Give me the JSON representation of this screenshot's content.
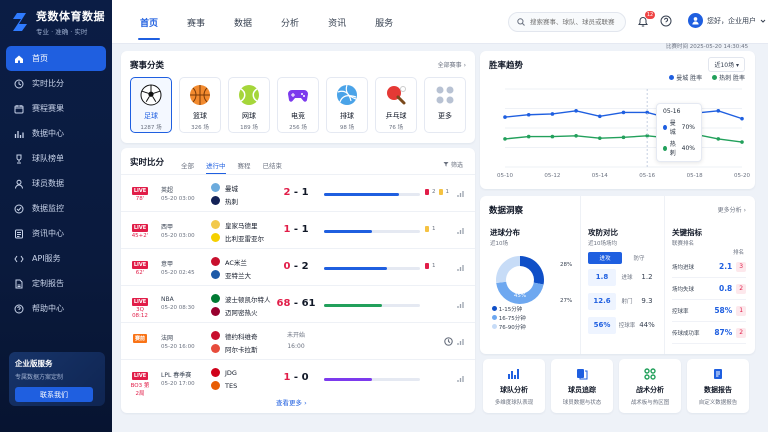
{
  "brand": {
    "title": "竞数体育数据",
    "subtitle": "专业 · 准确 · 实时"
  },
  "sidebar": {
    "items": [
      {
        "label": "首页",
        "icon": "home-icon",
        "active": true
      },
      {
        "label": "实时比分",
        "icon": "clock-icon"
      },
      {
        "label": "赛程赛果",
        "icon": "calendar-icon"
      },
      {
        "label": "数据中心",
        "icon": "chart-icon"
      },
      {
        "label": "球队榜单",
        "icon": "trophy-icon"
      },
      {
        "label": "球员数据",
        "icon": "user-icon"
      },
      {
        "label": "数据监控",
        "icon": "monitor-icon"
      },
      {
        "label": "资讯中心",
        "icon": "news-icon"
      },
      {
        "label": "API服务",
        "icon": "api-icon"
      },
      {
        "label": "定制报告",
        "icon": "report-icon"
      },
      {
        "label": "帮助中心",
        "icon": "help-icon"
      }
    ],
    "enterprise": {
      "title": "企业版服务",
      "subtitle": "专属数据方案定制",
      "button": "联系我们"
    }
  },
  "topnav": {
    "tabs": [
      "首页",
      "赛事",
      "数据",
      "分析",
      "资讯",
      "服务"
    ],
    "active": 0,
    "search_placeholder": "搜索赛事、球队、球员或联赛",
    "notification_count": "12",
    "user_name": "您好，企业用户"
  },
  "update_time": "比赛时间 2025-05-20 14:30:45",
  "sports": {
    "title": "赛事分类",
    "link": "全部赛事",
    "items": [
      {
        "name": "足球",
        "count": "1287 场",
        "icon": "soccer-ball-icon"
      },
      {
        "name": "篮球",
        "count": "326 场",
        "icon": "basketball-icon"
      },
      {
        "name": "网球",
        "count": "189 场",
        "icon": "tennis-ball-icon"
      },
      {
        "name": "电竞",
        "count": "256 场",
        "icon": "gamepad-icon"
      },
      {
        "name": "排球",
        "count": "98 场",
        "icon": "volleyball-icon"
      },
      {
        "name": "乒乓球",
        "count": "76 场",
        "icon": "pingpong-icon"
      },
      {
        "name": "更多",
        "count": "",
        "icon": "grid-dots-icon"
      }
    ]
  },
  "live": {
    "title": "实时比分",
    "filters": [
      "全部",
      "进行中",
      "赛程",
      "已结束"
    ],
    "active_filter": 1,
    "filter_btn": "筛选",
    "more": "查看更多",
    "matches": [
      {
        "status": "LIVE",
        "minute": "78'",
        "comp": "英超",
        "time": "05-20 03:00",
        "home": "曼城",
        "away": "热刺",
        "score_home": "2",
        "score_away": "1",
        "progress": 0.78,
        "bar_color": "#1f5fe0",
        "red": "2",
        "yellow": "1",
        "home_color": "#6cabdd",
        "away_color": "#132257"
      },
      {
        "status": "LIVE",
        "minute": "45+2'",
        "comp": "西甲",
        "time": "05-20 03:00",
        "home": "皇家马德里",
        "away": "比利亚雷亚尔",
        "score_home": "1",
        "score_away": "1",
        "progress": 0.5,
        "bar_color": "#1f5fe0",
        "red": "",
        "yellow": "1",
        "home_color": "#f2c94c",
        "away_color": "#f5d000"
      },
      {
        "status": "LIVE",
        "minute": "62'",
        "comp": "意甲",
        "time": "05-20 02:45",
        "home": "AC米兰",
        "away": "亚特兰大",
        "score_home": "0",
        "score_away": "2",
        "progress": 0.66,
        "bar_color": "#1f5fe0",
        "red": "1",
        "yellow": "",
        "home_color": "#c8102e",
        "away_color": "#1e5aa8"
      },
      {
        "status": "LIVE",
        "minute": "3Q 08:12",
        "comp": "NBA",
        "time": "05-20 08:30",
        "home": "波士顿凯尔特人",
        "away": "迈阿密热火",
        "score_home": "68",
        "score_away": "61",
        "progress": 0.6,
        "bar_color": "#22a05b",
        "red": "",
        "yellow": "",
        "home_color": "#007a33",
        "away_color": "#98002e"
      },
      {
        "status": "赛前",
        "minute": "",
        "comp": "法网",
        "time": "05-20 16:00",
        "home": "德约科维奇",
        "away": "阿尔卡拉斯",
        "pending": [
          "未开始",
          "16:00"
        ],
        "progress": 0,
        "bar_color": "#1f5fe0",
        "red": "",
        "yellow": "",
        "home_color": "#c8102e",
        "away_color": "#e74c3c"
      },
      {
        "status": "LIVE",
        "minute": "BO3 第2局",
        "comp": "LPL 春季赛",
        "time": "05-20 17:00",
        "home": "JDG",
        "away": "TES",
        "score_home": "1",
        "score_away": "0",
        "progress": 0.5,
        "bar_color": "#7c3aed",
        "red": "",
        "yellow": "",
        "home_color": "#d0021b",
        "away_color": "#e85d04"
      }
    ]
  },
  "trend": {
    "title": "胜率趋势",
    "range": "近10场",
    "legend": [
      "曼城 胜率",
      "热刺 胜率"
    ],
    "tooltip": {
      "date": "05-16",
      "rows": [
        {
          "team": "曼城",
          "value": "70%"
        },
        {
          "team": "热刺",
          "value": "40%"
        }
      ]
    }
  },
  "chart_data": {
    "type": "line",
    "x": [
      "05-10",
      "05-11",
      "05-12",
      "05-13",
      "05-14",
      "05-15",
      "05-16",
      "05-17",
      "05-18",
      "05-19",
      "05-20"
    ],
    "xticks": [
      "05-10",
      "05-12",
      "05-14",
      "05-16",
      "05-18",
      "05-20"
    ],
    "ylim": [
      0,
      100
    ],
    "series": [
      {
        "name": "曼城 胜率",
        "color": "#1f5fe0",
        "values": [
          64,
          67,
          68,
          72,
          65,
          70,
          70,
          62,
          69,
          72,
          62
        ]
      },
      {
        "name": "热刺 胜率",
        "color": "#22a05b",
        "values": [
          36,
          39,
          39,
          40,
          37,
          38,
          40,
          37,
          42,
          36,
          32
        ]
      }
    ]
  },
  "insight": {
    "title": "数据洞察",
    "link": "更多分析",
    "shots": {
      "title": "进球分布",
      "note": "近10场",
      "labels": [
        "28%",
        "45%",
        "27%"
      ],
      "legend": [
        "1-15分钟",
        "16-75分钟",
        "76-90分钟"
      ],
      "colors": [
        "#0f4fc7",
        "#6ea8f0",
        "#c7dcf7"
      ],
      "values": [
        28,
        45,
        27
      ]
    },
    "attack": {
      "title": "攻防对比",
      "note": "近10场场均",
      "heads": [
        "进攻",
        "防守"
      ],
      "rows": [
        {
          "left": "1.8",
          "label": "进球",
          "right": "1.2"
        },
        {
          "left": "12.6",
          "label": "射门",
          "right": "9.3"
        },
        {
          "left": "56%",
          "label": "控球率",
          "right": "44%"
        }
      ]
    },
    "key": {
      "title": "关键指标",
      "note": "联赛排名",
      "head": "排名",
      "rows": [
        {
          "label": "场均进球",
          "value": "2.1",
          "rank": "3"
        },
        {
          "label": "场均失球",
          "value": "0.8",
          "rank": "2"
        },
        {
          "label": "控球率",
          "value": "58%",
          "rank": "1"
        },
        {
          "label": "传球成功率",
          "value": "87%",
          "rank": "2"
        }
      ]
    }
  },
  "quick": [
    {
      "title": "球队分析",
      "sub": "多维度球队表现",
      "icon": "team-analysis-icon"
    },
    {
      "title": "球员追踪",
      "sub": "球员数据与状态",
      "icon": "player-track-icon"
    },
    {
      "title": "战术分析",
      "sub": "战术板与热区图",
      "icon": "tactics-icon"
    },
    {
      "title": "数据报告",
      "sub": "自定义数据报告",
      "icon": "report-doc-icon"
    }
  ]
}
